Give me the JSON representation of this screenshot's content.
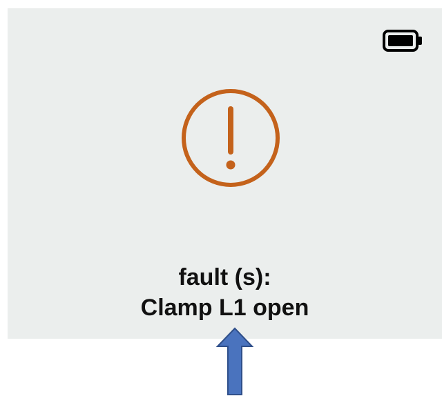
{
  "status_bar": {
    "battery_icon": "battery-full-icon"
  },
  "alert": {
    "icon": "warning-exclamation-icon",
    "icon_color": "#c4621b",
    "heading": "fault (s):",
    "detail": "Clamp L1 open"
  },
  "annotation": {
    "icon": "up-arrow-icon",
    "fill_color": "#4a73be",
    "stroke_color": "#2f4f8a"
  },
  "colors": {
    "screen_background": "#ebeeed",
    "text": "#111111"
  }
}
